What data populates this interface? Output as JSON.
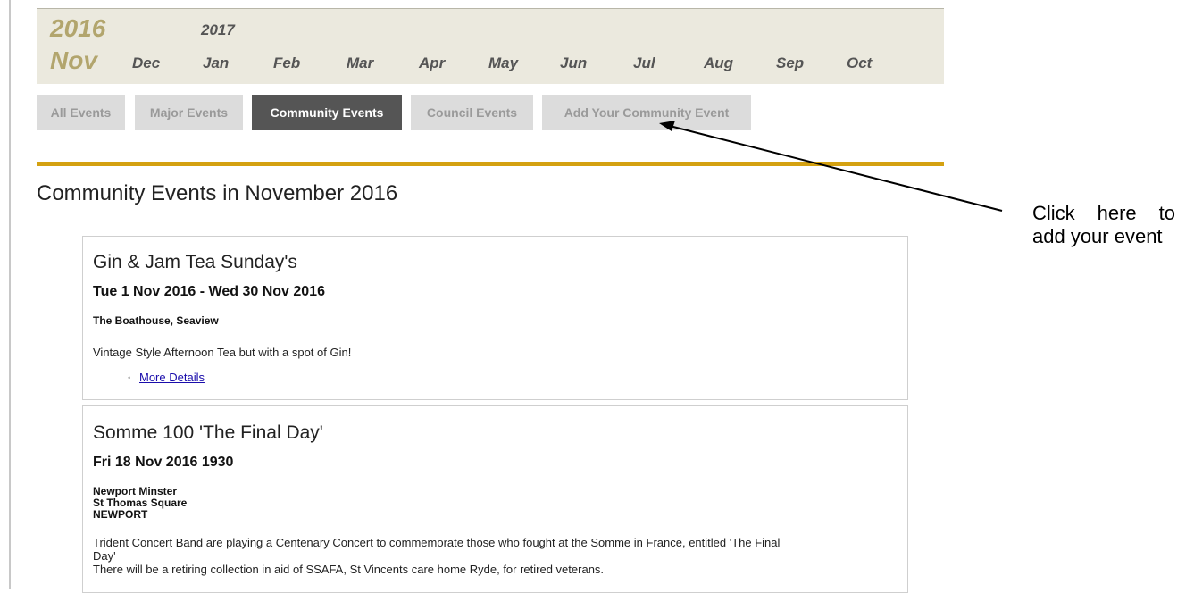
{
  "calendar": {
    "current_year": "2016",
    "current_month": "Nov",
    "next_year": "2017",
    "months": [
      "Dec",
      "Jan",
      "Feb",
      "Mar",
      "Apr",
      "May",
      "Jun",
      "Jul",
      "Aug",
      "Sep",
      "Oct"
    ]
  },
  "tabs": [
    {
      "label": "All Events",
      "active": false
    },
    {
      "label": "Major Events",
      "active": false
    },
    {
      "label": "Community Events",
      "active": true
    },
    {
      "label": "Council Events",
      "active": false
    },
    {
      "label": "Add Your Community Event",
      "active": false
    }
  ],
  "page_title": "Community Events in November 2016",
  "events": [
    {
      "title": "Gin & Jam Tea Sunday's",
      "date": "Tue 1 Nov 2016 - Wed 30 Nov 2016",
      "venue_lines": [
        "The Boathouse, Seaview"
      ],
      "description": "Vintage Style Afternoon Tea but with a spot of Gin!",
      "link": "More Details"
    },
    {
      "title": "Somme 100 'The Final Day'",
      "date": "Fri 18 Nov 2016 1930",
      "venue_lines": [
        "Newport Minster",
        "St Thomas Square",
        "NEWPORT"
      ],
      "description_lines": [
        "Trident Concert Band are playing a Centenary Concert to commemorate those who fought at the Somme in France, entitled 'The Final",
        "Day'",
        "There will be a retiring collection in aid of SSAFA, St Vincents care home Ryde, for retired veterans."
      ]
    }
  ],
  "annotation": {
    "text": "Click here to add your event"
  },
  "colors": {
    "gold_accent": "#d4a111",
    "month_bar": "#ebe9de",
    "year_text": "#b2a56d",
    "active_tab": "#555555",
    "inactive_tab": "#dcdcdc"
  }
}
